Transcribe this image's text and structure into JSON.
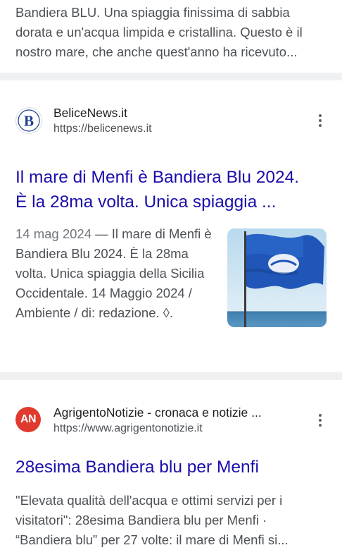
{
  "top_result": {
    "snippet": "Bandiera BLU. Una spiaggia finissima di sabbia dorata e un'acqua limpida e cristallina. Questo è il nostro mare, che anche quest'anno ha ricevuto..."
  },
  "results": [
    {
      "site_name": "BeliceNews.it",
      "url": "https://belicenews.it",
      "favicon_letter": "B",
      "title_line1": "Il mare di Menfi è Bandiera Blu 2024.",
      "title_line2": "È la 28ma volta. Unica spiaggia ...",
      "date": "14 mag 2024",
      "snippet": " — Il mare di Menfi è Bandiera Blu 2024. È la 28ma volta. Unica spiaggia della Sicilia Occidentale. 14 Maggio 2024 / Ambiente / di: redazione. ◊.",
      "thumbnail": "blue-flag-photo"
    },
    {
      "site_name": "AgrigentoNotizie - cronaca e notizie ...",
      "url": "https://www.agrigentonotizie.it",
      "favicon_letter": "AN",
      "title": "28esima Bandiera blu per Menfi",
      "snippet": "\"Elevata qualità dell'acqua e ottimi servizi per i visitatori\": 28esima Bandiera blu per Menfi · “Bandiera blu” per 27 volte: il mare di Menfi si..."
    }
  ],
  "colors": {
    "link": "#1a0dab",
    "text": "#4d5156",
    "divider": "#eef0f2",
    "belice_favicon": "#1c3f8f",
    "an_favicon": "#e03a2f"
  },
  "icons": {
    "more": "three-dots-vertical-icon"
  }
}
